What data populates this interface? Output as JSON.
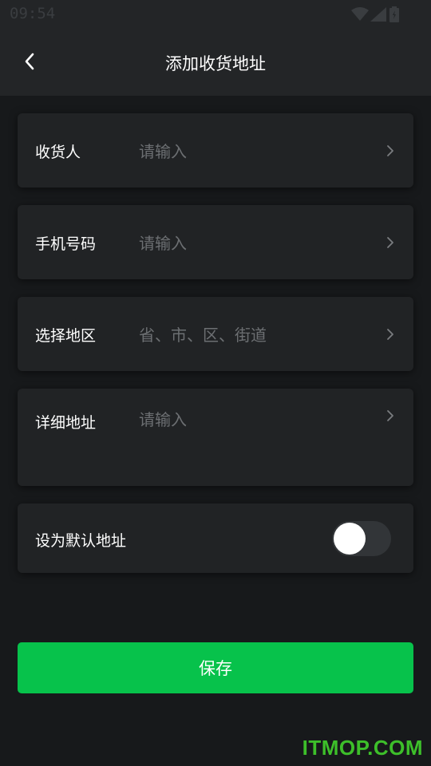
{
  "status_bar": {
    "time": "09:54"
  },
  "app_bar": {
    "title": "添加收货地址"
  },
  "form": {
    "recipient": {
      "label": "收货人",
      "placeholder": "请输入"
    },
    "phone": {
      "label": "手机号码",
      "placeholder": "请输入"
    },
    "region": {
      "label": "选择地区",
      "placeholder": "省、市、区、街道"
    },
    "detail": {
      "label": "详细地址",
      "placeholder": "请输入"
    },
    "default_address": {
      "label": "设为默认地址",
      "enabled": false
    }
  },
  "save_button": {
    "label": "保存"
  },
  "watermark": {
    "text": "ITMOP.COM"
  },
  "colors": {
    "accent": "#07c24b",
    "background": "#17191b",
    "card": "#212325",
    "placeholder": "#6c6f72"
  }
}
